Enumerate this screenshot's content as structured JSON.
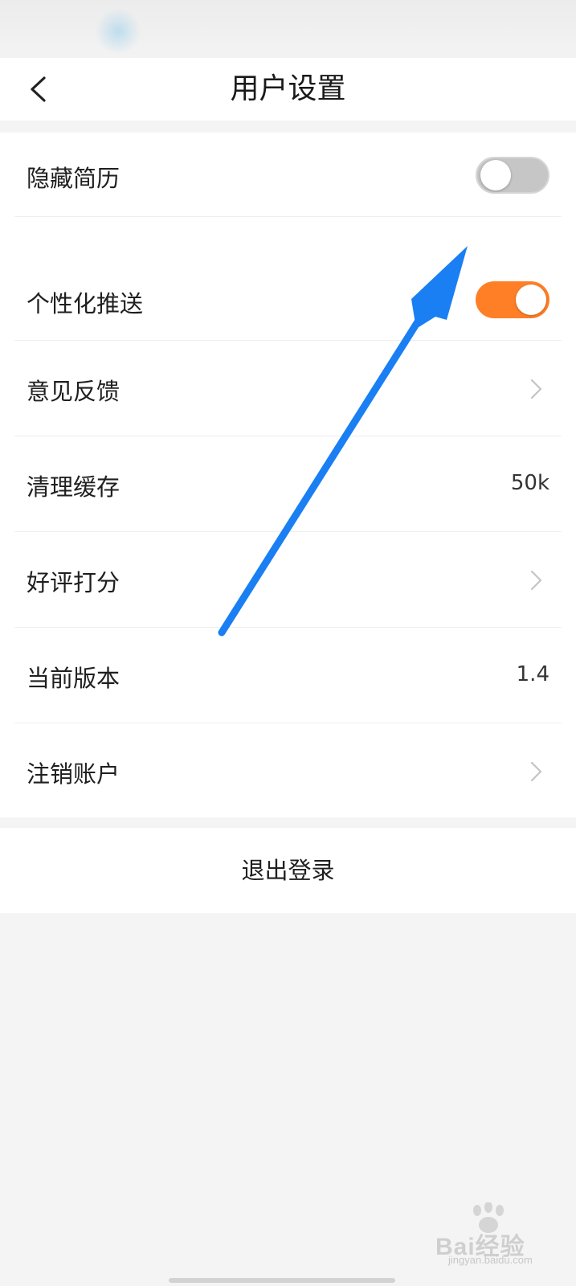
{
  "header": {
    "title": "用户设置",
    "back_icon": "chevron-left-icon"
  },
  "settings": [
    {
      "key": "hide-resume",
      "label": "隐藏简历",
      "control": "toggle",
      "toggle_on": false
    },
    {
      "key": "personalized-push",
      "label": "个性化推送",
      "control": "toggle",
      "toggle_on": true
    },
    {
      "key": "feedback",
      "label": "意见反馈",
      "control": "chevron",
      "icon": "chevron-right-icon"
    },
    {
      "key": "clear-cache",
      "label": "清理缓存",
      "control": "value",
      "value": "50k"
    },
    {
      "key": "rate-app",
      "label": "好评打分",
      "control": "chevron",
      "icon": "chevron-right-icon"
    },
    {
      "key": "current-version",
      "label": "当前版本",
      "control": "value",
      "value": "1.4"
    },
    {
      "key": "deactivate-account",
      "label": "注销账户",
      "control": "chevron",
      "icon": "chevron-right-icon"
    }
  ],
  "logout": {
    "label": "退出登录"
  },
  "annotation": {
    "icon": "arrow-annotation-icon",
    "color": "#1a7ff2"
  },
  "watermark": {
    "brand": "Bai经验",
    "sub": "jingyan.baidu.com"
  },
  "colors": {
    "accent_orange": "#ff7f27",
    "toggle_off": "#c6c6c6",
    "background": "#f4f4f4"
  }
}
